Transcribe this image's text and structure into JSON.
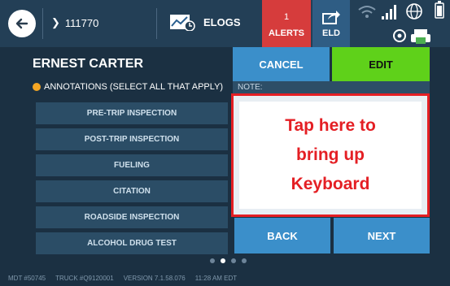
{
  "topbar": {
    "truck_id": "111770",
    "elogs_label": "ELOGS",
    "alerts_count": "1",
    "alerts_label": "ALERTS",
    "eld_label": "ELD"
  },
  "driver_name": "ERNEST CARTER",
  "annotations_heading": "ANNOTATIONS (SELECT ALL THAT APPLY)",
  "annotation_options": [
    "PRE-TRIP INSPECTION",
    "POST-TRIP INSPECTION",
    "FUELING",
    "CITATION",
    "ROADSIDE INSPECTION",
    "ALCOHOL DRUG TEST"
  ],
  "buttons": {
    "cancel": "CANCEL",
    "edit": "EDIT",
    "back": "BACK",
    "next": "NEXT"
  },
  "note": {
    "label": "NOTE:",
    "overlay_line1": "Tap here to",
    "overlay_line2": "bring up",
    "overlay_line3": "Keyboard"
  },
  "pager": {
    "pages": 4,
    "current": 2
  },
  "footer": {
    "mdt": "MDT #50745",
    "truck": "TRUCK #Q9120001",
    "version": "VERSION  7.1.58.076",
    "time": "11:28 AM EDT"
  },
  "colors": {
    "background": "#1b3042",
    "topbar": "#233f56",
    "alerts": "#d63c3c",
    "eld": "#2f5d84",
    "button_blue": "#3b8fca",
    "edit_green": "#5fd11a",
    "highlight_red": "#e41f24",
    "annotation_dot": "#f5a623"
  }
}
